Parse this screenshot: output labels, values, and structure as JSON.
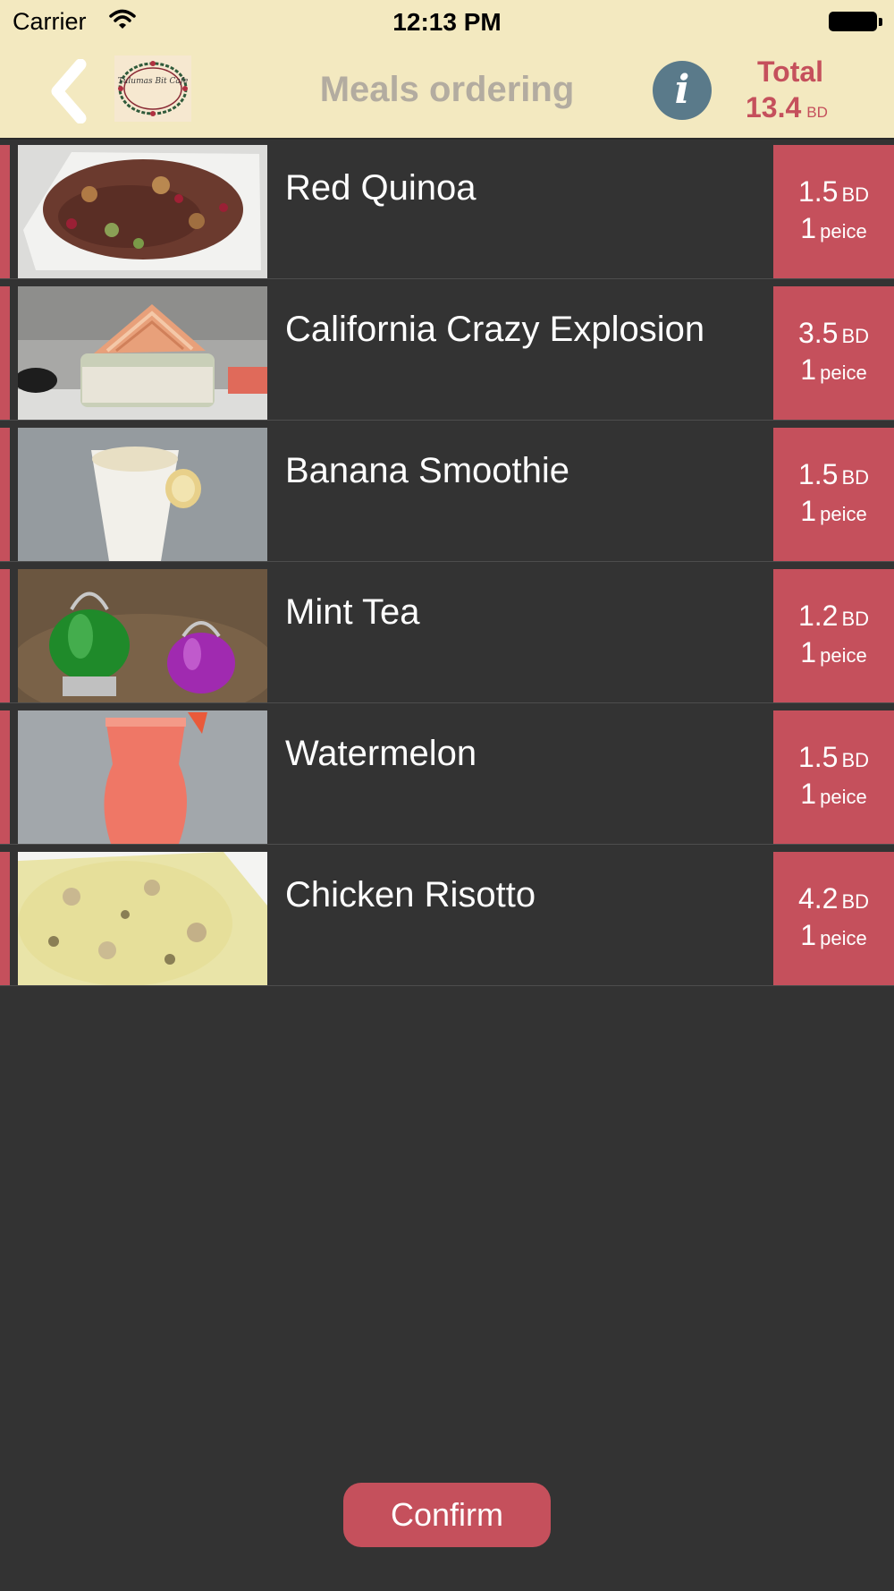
{
  "status_bar": {
    "carrier": "Carrier",
    "time": "12:13 PM"
  },
  "header": {
    "title": "Meals ordering",
    "logo_text": "Tulumas Bit Cafe",
    "info_symbol": "i",
    "total_label": "Total",
    "total_value": "13.4",
    "total_unit": "BD"
  },
  "items": [
    {
      "name": "Red Quinoa",
      "price": "1.5",
      "currency": "BD",
      "qty": "1",
      "qty_unit": "peice"
    },
    {
      "name": "California Crazy Explosion",
      "price": "3.5",
      "currency": "BD",
      "qty": "1",
      "qty_unit": "peice"
    },
    {
      "name": "Banana Smoothie",
      "price": "1.5",
      "currency": "BD",
      "qty": "1",
      "qty_unit": "peice"
    },
    {
      "name": "Mint Tea",
      "price": "1.2",
      "currency": "BD",
      "qty": "1",
      "qty_unit": "peice"
    },
    {
      "name": "Watermelon",
      "price": "1.5",
      "currency": "BD",
      "qty": "1",
      "qty_unit": "peice"
    },
    {
      "name": "Chicken Risotto",
      "price": "4.2",
      "currency": "BD",
      "qty": "1",
      "qty_unit": "peice"
    }
  ],
  "confirm_label": "Confirm",
  "colors": {
    "accent": "#c5505c",
    "header_bg": "#f3e9c0",
    "body_bg": "#333333",
    "info_bg": "#5a7a8a",
    "title_gray": "#b3aca0"
  },
  "icons": {
    "back": "chevron-left-icon",
    "info": "info-icon",
    "wifi": "wifi-icon",
    "battery": "battery-icon"
  }
}
